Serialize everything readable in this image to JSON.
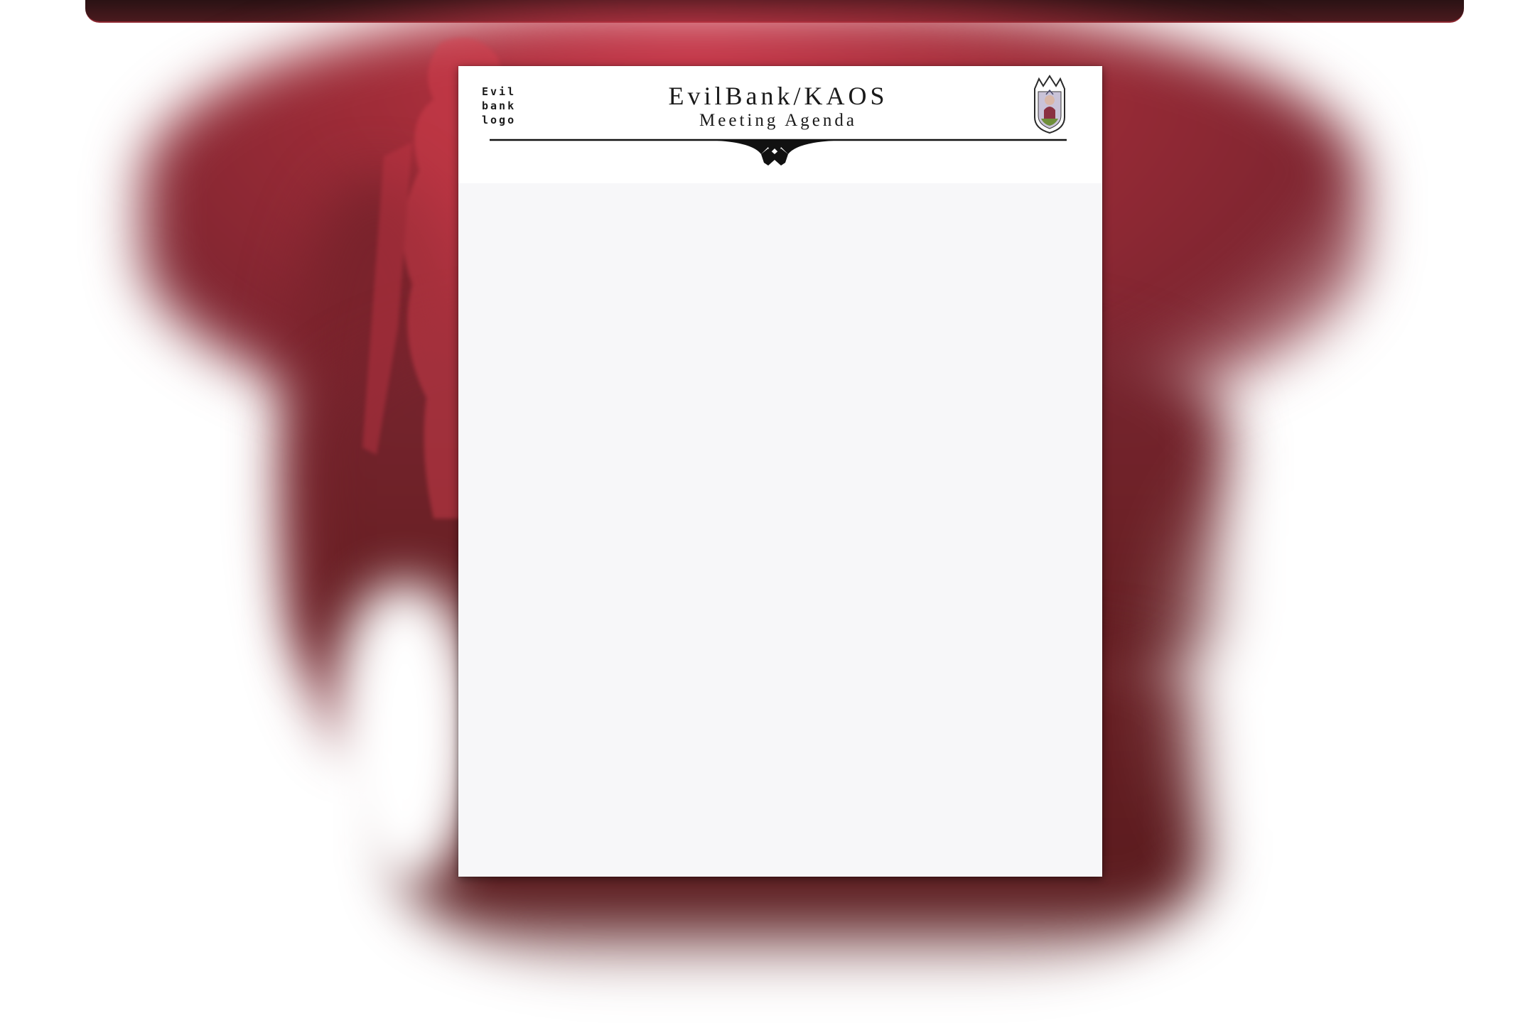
{
  "document": {
    "logo_placeholder": "Evil\nbank\nlogo",
    "title": "EvilBank/KAOS",
    "subtitle": "Meeting Agenda",
    "crest_icon": "shield-crest-icon"
  },
  "colors": {
    "background_red": "#a02c38",
    "background_dark": "#5e1c20",
    "paper": "#f7f7f9",
    "ink": "#1a1a1a"
  }
}
